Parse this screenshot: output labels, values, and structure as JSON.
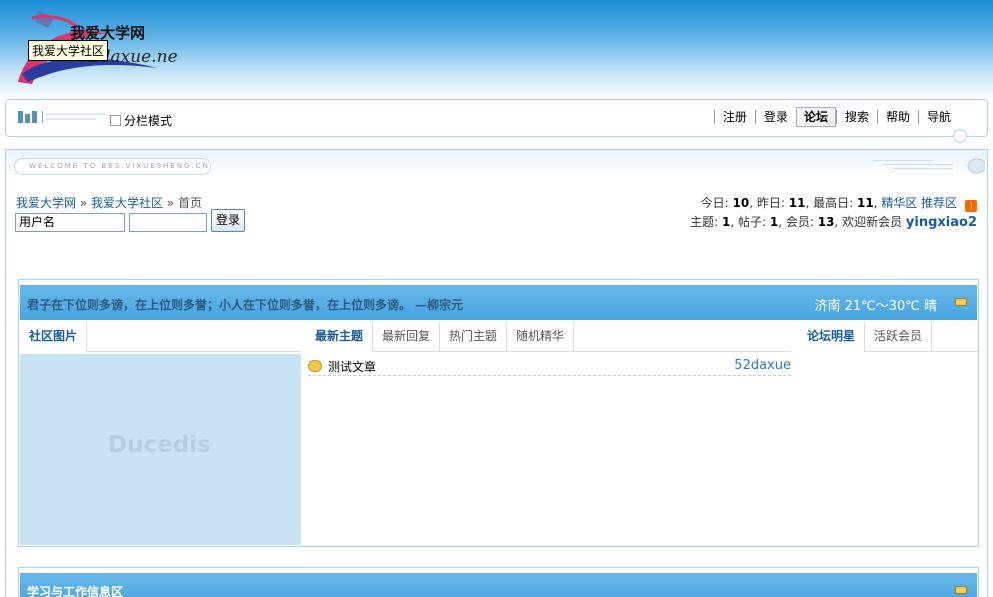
{
  "header": {
    "logo_title": "我爱大学网",
    "logo_url": "52daxue.net",
    "tooltip": "我爱大学社区"
  },
  "navbar": {
    "split_mode_label": "分栏模式",
    "links": [
      "注册",
      "登录",
      "论坛",
      "搜索",
      "帮助",
      "导航"
    ],
    "active": "论坛"
  },
  "welcome": "WELCOME TO BBS.VIXUESHENG.CN",
  "breadcrumb": {
    "home": "我爱大学网",
    "sep": "»",
    "community": "我爱大学社区",
    "current": "首页"
  },
  "login": {
    "username_placeholder": "用户名",
    "button": "登录"
  },
  "stats": {
    "today_label": "今日:",
    "today": "10",
    "yesterday_label": "昨日:",
    "yesterday": "11",
    "max_label": "最高日:",
    "max": "11",
    "digest": "精华区",
    "recommend": "推荐区",
    "topics_label": "主题:",
    "topics": "1",
    "posts_label": "帖子:",
    "posts": "1",
    "members_label": "会员:",
    "members": "13",
    "welcome_label": "欢迎新会员",
    "new_member": "yingxiao2"
  },
  "box1": {
    "motto": "君子在下位则多谤，在上位则多誉；小人在下位则多誉，在上位则多谤。 —柳宗元",
    "weather": "济南  21℃～30℃ 晴",
    "left_tab": "社区图片",
    "watermark": "Ducedis",
    "mid_tabs": [
      "最新主题",
      "最新回复",
      "热门主题",
      "随机精华"
    ],
    "topic": {
      "title": "测试文章",
      "author": "52daxue"
    },
    "right_tabs": [
      "论坛明星",
      "活跃会员"
    ]
  },
  "box2": {
    "title": "学习与工作信息区"
  },
  "colors": {
    "accent": "#48a4de",
    "link": "#1a5c9a",
    "border": "#a9d3ee"
  }
}
